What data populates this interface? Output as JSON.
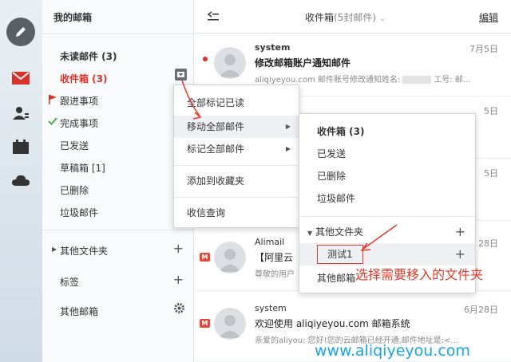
{
  "rail": {
    "icons": [
      "pencil-icon",
      "envelope-icon",
      "contacts-icon",
      "calendar-icon",
      "cloud-icon"
    ]
  },
  "folders": {
    "title": "我的邮箱",
    "unread": "未读邮件 (3)",
    "inbox": "收件箱 (3)",
    "followup": "跟进事项",
    "done": "完成事项",
    "sent": "已发送",
    "drafts": "草稿箱 [1]",
    "deleted": "已删除",
    "spam": "垃圾邮件",
    "other_folders": "其他文件夹",
    "tags": "标签",
    "other_mailboxes": "其他邮箱"
  },
  "header": {
    "title": "收件箱",
    "count": "(5封邮件)",
    "edit": "编辑"
  },
  "mails": [
    {
      "sender": "system",
      "subject": "修改邮箱账户通知邮件",
      "preview": "aliqiyeyou.com 邮件账号修改通知姓名:",
      "preview_tail": "工号: 邮...",
      "date": "7月5日"
    },
    {
      "sender": "Alimail",
      "subject": "【阿里云",
      "preview": "尊敬的用户",
      "date": "28日"
    },
    {
      "sender": "system",
      "subject": "欢迎使用 aliqiyeyou.com 邮箱系统",
      "preview": "亲爱的aliyou: 您好!您的云邮箱已经开通,邮件地址是:<...",
      "date": "6月28日"
    }
  ],
  "hidden_dates": [
    "5日",
    "5日",
    "5日"
  ],
  "menu1": {
    "items": [
      "全部标记已读",
      "移动全部邮件",
      "标记全部邮件",
      "添加到收藏夹",
      "收信查询"
    ]
  },
  "menu2": {
    "items": [
      "收件箱 (3)",
      "已发送",
      "已删除",
      "垃圾邮件"
    ],
    "other_folders": "其他文件夹",
    "test_folder": "测试1",
    "other_mailboxes": "其他邮箱"
  },
  "annotation": "选择需要移入的文件夹",
  "watermark": "www.aliqiyeyou.com",
  "colors": {
    "accent_red": "#d9322b",
    "watermark_blue": "#1aa3e8",
    "annotation_red": "#e43a2a"
  }
}
